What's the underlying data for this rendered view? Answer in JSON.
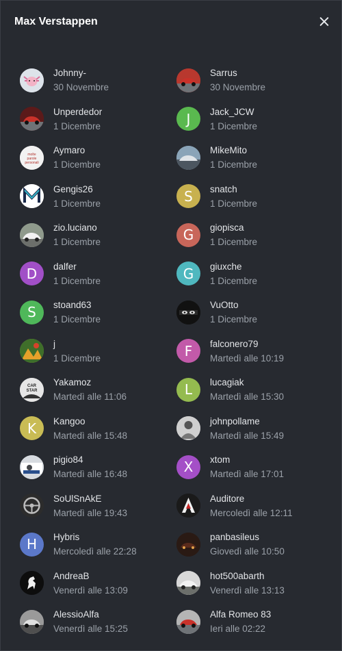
{
  "dialog": {
    "title": "Max Verstappen"
  },
  "users": [
    {
      "name": "Johnny-",
      "date": "30 Novembre",
      "icon": "axolotl-photo-icon",
      "bg": "#dde3ea"
    },
    {
      "name": "Sarrus",
      "date": "30 Novembre",
      "icon": "red-car-photo-icon",
      "bg": "#b8382e"
    },
    {
      "name": "Unperdedor",
      "date": "1 Dicembre",
      "icon": "red-car-photo-icon",
      "bg": "#5b1a1a"
    },
    {
      "name": "Jack_JCW",
      "date": "1 Dicembre",
      "letter": "J",
      "bg": "#5ab94f"
    },
    {
      "name": "Aymaro",
      "date": "1 Dicembre",
      "icon": "text-logo-photo-icon",
      "bg": "#f2f2f2"
    },
    {
      "name": "MikeMito",
      "date": "1 Dicembre",
      "icon": "car-photo-icon",
      "bg": "#8aa4b8"
    },
    {
      "name": "Gengis26",
      "date": "1 Dicembre",
      "icon": "m-logo-icon",
      "bg": "#ffffff"
    },
    {
      "name": "snatch",
      "date": "1 Dicembre",
      "letter": "S",
      "bg": "#c8b14f"
    },
    {
      "name": "zio.luciano",
      "date": "1 Dicembre",
      "icon": "white-car-photo-icon",
      "bg": "#8f9a8c"
    },
    {
      "name": "giopisca",
      "date": "1 Dicembre",
      "letter": "G",
      "bg": "#c8665a"
    },
    {
      "name": "dalfer",
      "date": "1 Dicembre",
      "letter": "D",
      "bg": "#a14fc7"
    },
    {
      "name": "giuxche",
      "date": "1 Dicembre",
      "letter": "G",
      "bg": "#4fb8bf"
    },
    {
      "name": "stoand63",
      "date": "1 Dicembre",
      "letter": "S",
      "bg": "#4fb85a"
    },
    {
      "name": "VuOtto",
      "date": "1 Dicembre",
      "icon": "eyes-photo-icon",
      "bg": "#111111"
    },
    {
      "name": "j",
      "date": "1 Dicembre",
      "icon": "painting-photo-icon",
      "bg": "#6a8c3a"
    },
    {
      "name": "falconero79",
      "date": "Martedì alle 10:19",
      "letter": "F",
      "bg": "#c25aa9"
    },
    {
      "name": "Yakamoz",
      "date": "Martedì alle 11:06",
      "icon": "car-star-logo-icon",
      "bg": "#e6e6e6"
    },
    {
      "name": "lucagiak",
      "date": "Martedì alle 15:30",
      "letter": "L",
      "bg": "#94bb4f"
    },
    {
      "name": "Kangoo",
      "date": "Martedì alle 15:48",
      "letter": "K",
      "bg": "#c9bc55"
    },
    {
      "name": "johnpollame",
      "date": "Martedì alle 15:49",
      "icon": "person-photo-icon",
      "bg": "#cfcfcf"
    },
    {
      "name": "pigio84",
      "date": "Martedì alle 16:48",
      "icon": "person-car-photo-icon",
      "bg": "#d7dbe0"
    },
    {
      "name": "xtom",
      "date": "Martedì alle 17:01",
      "letter": "X",
      "bg": "#a44fc7"
    },
    {
      "name": "SoUlSnAkE",
      "date": "Martedì alle 19:43",
      "icon": "steering-wheel-photo-icon",
      "bg": "#2c2c2c"
    },
    {
      "name": "Auditore",
      "date": "Mercoledì alle 12:11",
      "icon": "assassin-logo-icon",
      "bg": "#1a1a1a"
    },
    {
      "name": "Hybris",
      "date": "Mercoledì alle 22:28",
      "letter": "H",
      "bg": "#5b78c9"
    },
    {
      "name": "panbasileus",
      "date": "Giovedì alle 10:50",
      "icon": "dark-car-photo-icon",
      "bg": "#2a1a14"
    },
    {
      "name": "AndreaB",
      "date": "Venerdì alle 13:09",
      "icon": "prancing-horse-logo-icon",
      "bg": "#0d0d0d"
    },
    {
      "name": "hot500abarth",
      "date": "Venerdì alle 13:13",
      "icon": "white-car-photo-icon",
      "bg": "#d8d8d8"
    },
    {
      "name": "AlessioAlfa",
      "date": "Venerdì alle 15:25",
      "icon": "bw-car-photo-icon",
      "bg": "#9a9a9a"
    },
    {
      "name": "Alfa Romeo 83",
      "date": "Ieri alle 02:22",
      "icon": "red-car-photo-icon",
      "bg": "#b5b5b5"
    }
  ]
}
